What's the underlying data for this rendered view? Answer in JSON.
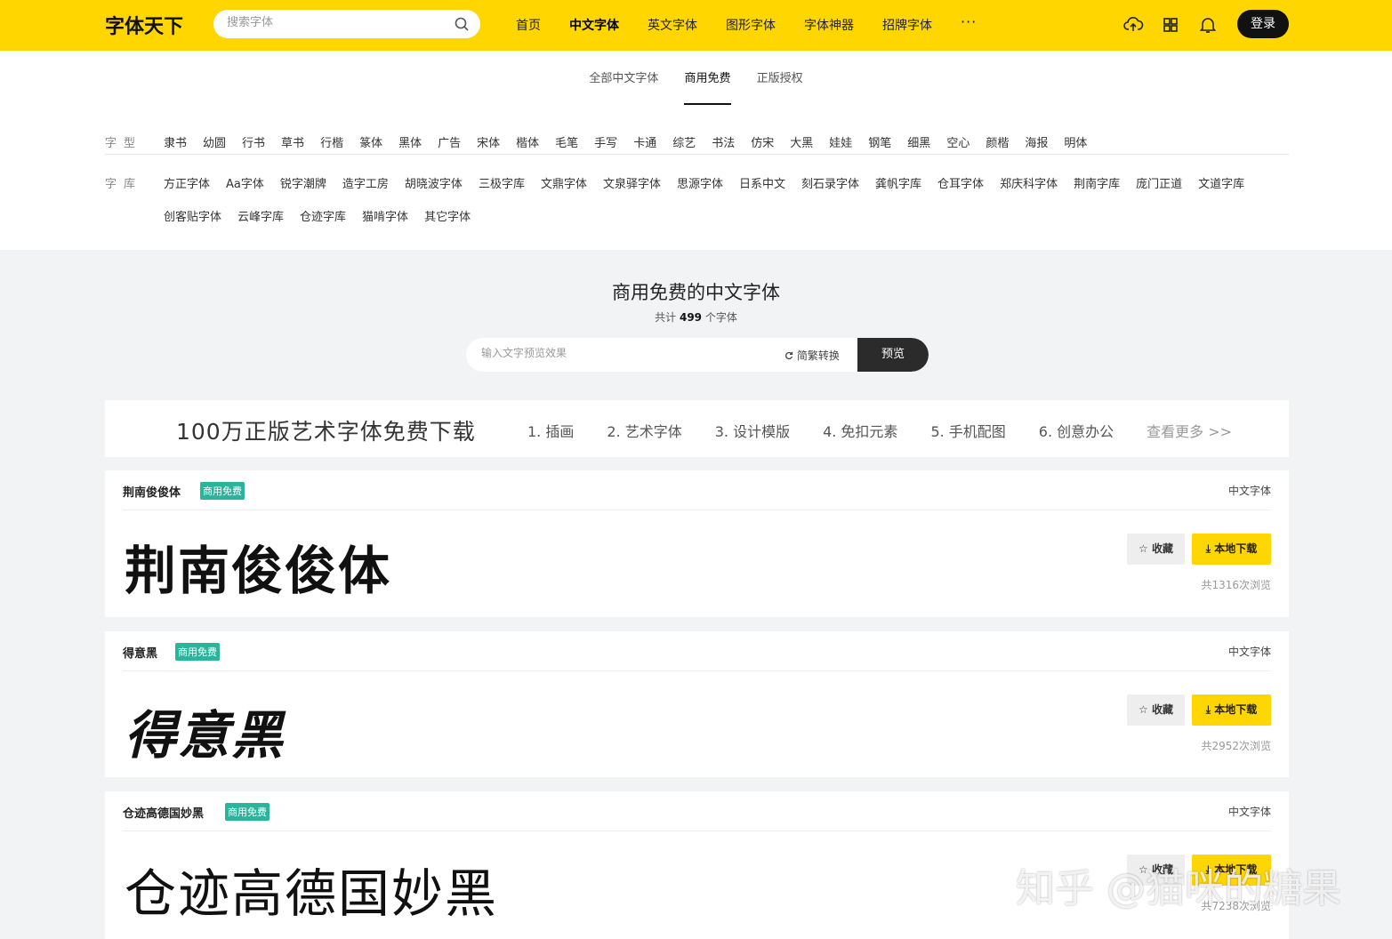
{
  "header": {
    "logo": "字体天下",
    "search_placeholder": "搜索字体",
    "nav": [
      "首页",
      "中文字体",
      "英文字体",
      "图形字体",
      "字体神器",
      "招牌字体"
    ],
    "nav_more": "···",
    "login": "登录",
    "icons": [
      "upload-cloud-icon",
      "grid-icon",
      "bell-icon"
    ]
  },
  "subtabs": [
    "全部中文字体",
    "商用免费",
    "正版授权"
  ],
  "filters": {
    "type_label": "字型",
    "types": [
      "隶书",
      "幼圆",
      "行书",
      "草书",
      "行楷",
      "篆体",
      "黑体",
      "广告",
      "宋体",
      "楷体",
      "毛笔",
      "手写",
      "卡通",
      "综艺",
      "书法",
      "仿宋",
      "大黑",
      "娃娃",
      "钢笔",
      "细黑",
      "空心",
      "颜楷",
      "海报",
      "明体"
    ],
    "lib_label": "字库",
    "libs": [
      "方正字体",
      "Aa字体",
      "锐字潮牌",
      "造字工房",
      "胡晓波字体",
      "三极字库",
      "文鼎字体",
      "文泉驿字体",
      "思源字体",
      "日系中文",
      "刻石录字体",
      "龚帆字库",
      "仓耳字体",
      "郑庆科字体",
      "荆南字库",
      "庞门正道",
      "文道字库",
      "创客贴字体",
      "云峰字库",
      "仓迹字库",
      "猫啃字体",
      "其它字体"
    ]
  },
  "section": {
    "title": "商用免费的中文字体",
    "count_prefix": "共计",
    "count": "499",
    "count_suffix": "个字体",
    "preview_placeholder": "输入文字预览效果",
    "convert": "简繁转换",
    "preview_btn": "预览"
  },
  "banner": {
    "headline": "100万正版艺术字体免费下载",
    "links": [
      "1. 插画",
      "2. 艺术字体",
      "3. 设计模版",
      "4. 免扣元素",
      "5. 手机配图",
      "6. 创意办公"
    ],
    "more": "查看更多 >>"
  },
  "fonts": [
    {
      "name": "荆南俊俊体",
      "tag": "商用免费",
      "category": "中文字体",
      "sample": "荆南俊俊体",
      "fav": "收藏",
      "download": "本地下载",
      "views": "共1316次浏览"
    },
    {
      "name": "得意黑",
      "tag": "商用免费",
      "category": "中文字体",
      "sample": "得意黑",
      "fav": "收藏",
      "download": "本地下载",
      "views": "共2952次浏览"
    },
    {
      "name": "仓迹高德国妙黑",
      "tag": "商用免费",
      "category": "中文字体",
      "sample": "仓迹高德国妙黑",
      "fav": "收藏",
      "download": "本地下载",
      "views": "共7238次浏览"
    }
  ],
  "watermark": "知乎 @猫咪的糖果"
}
